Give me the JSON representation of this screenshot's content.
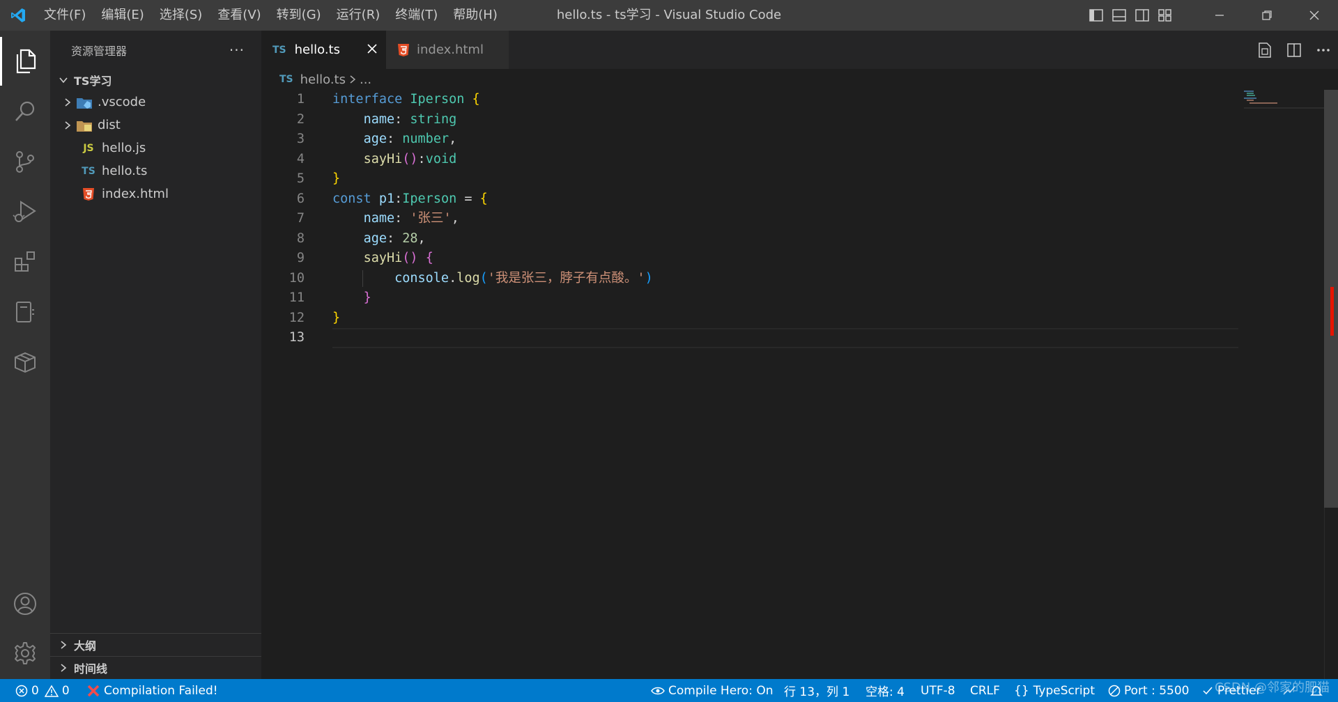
{
  "titlebar": {
    "window_title": "hello.ts - ts学习 - Visual Studio Code",
    "menu": [
      "文件(F)",
      "编辑(E)",
      "选择(S)",
      "查看(V)",
      "转到(G)",
      "运行(R)",
      "终端(T)",
      "帮助(H)"
    ],
    "logo_icon": "vscode-logo-icon",
    "layout_icons": [
      "toggle-primary-sidebar-icon",
      "toggle-panel-icon",
      "toggle-secondary-sidebar-icon",
      "customize-layout-icon"
    ],
    "window_controls": [
      "minimize-icon",
      "restore-icon",
      "close-icon"
    ]
  },
  "activity_bar": {
    "items": [
      "explorer-icon",
      "search-icon",
      "source-control-icon",
      "run-debug-icon",
      "extensions-icon",
      "remote-explorer-icon",
      "package-icon"
    ],
    "bottom": [
      "accounts-icon",
      "manage-gear-icon"
    ],
    "active": "explorer-icon"
  },
  "sidebar": {
    "title": "资源管理器",
    "more": "···",
    "root": "TS学习",
    "items": [
      {
        "label": ".vscode",
        "kind": "folder",
        "icon": "vscode-folder-icon"
      },
      {
        "label": "dist",
        "kind": "folder",
        "icon": "folder-icon"
      },
      {
        "label": "hello.js",
        "kind": "file",
        "badge": "JS",
        "badge_color": "#cbcb41"
      },
      {
        "label": "hello.ts",
        "kind": "file",
        "badge": "TS",
        "badge_color": "#519aba"
      },
      {
        "label": "index.html",
        "kind": "file",
        "icon": "html5-icon",
        "badge_color": "#e44d26"
      }
    ],
    "sections": [
      "大纲",
      "时间线"
    ]
  },
  "tabs": [
    {
      "label": "hello.ts",
      "lang": "TS",
      "active": true
    },
    {
      "label": "index.html",
      "lang": "html5",
      "active": false
    }
  ],
  "breadcrumb": {
    "lang": "TS",
    "file": "hello.ts",
    "rest": "..."
  },
  "editor": {
    "current_line": 13,
    "lines": [
      [
        [
          "kw",
          "interface"
        ],
        [
          "op",
          " "
        ],
        [
          "ty",
          "Iperson"
        ],
        [
          "op",
          " "
        ],
        [
          "b1",
          "{"
        ]
      ],
      [
        [
          "op",
          "    "
        ],
        [
          "pr",
          "name"
        ],
        [
          "op",
          ": "
        ],
        [
          "ty",
          "string"
        ]
      ],
      [
        [
          "op",
          "    "
        ],
        [
          "pr",
          "age"
        ],
        [
          "op",
          ": "
        ],
        [
          "ty",
          "number"
        ],
        [
          "op",
          ","
        ]
      ],
      [
        [
          "op",
          "    "
        ],
        [
          "fn",
          "sayHi"
        ],
        [
          "b2",
          "()"
        ],
        [
          "op",
          ":"
        ],
        [
          "ty",
          "void"
        ]
      ],
      [
        [
          "b1",
          "}"
        ]
      ],
      [
        [
          "kw",
          "const"
        ],
        [
          "op",
          " "
        ],
        [
          "pr",
          "p1"
        ],
        [
          "op",
          ":"
        ],
        [
          "ty",
          "Iperson"
        ],
        [
          "op",
          " = "
        ],
        [
          "b1",
          "{"
        ]
      ],
      [
        [
          "op",
          "    "
        ],
        [
          "pr",
          "name"
        ],
        [
          "op",
          ": "
        ],
        [
          "st",
          "'张三'"
        ],
        [
          "op",
          ","
        ]
      ],
      [
        [
          "op",
          "    "
        ],
        [
          "pr",
          "age"
        ],
        [
          "op",
          ": "
        ],
        [
          "nu",
          "28"
        ],
        [
          "op",
          ","
        ]
      ],
      [
        [
          "op",
          "    "
        ],
        [
          "fn",
          "sayHi"
        ],
        [
          "b2",
          "()"
        ],
        [
          "op",
          " "
        ],
        [
          "b2",
          "{"
        ]
      ],
      [
        [
          "op",
          "        "
        ],
        [
          "pr",
          "console"
        ],
        [
          "op",
          "."
        ],
        [
          "fn",
          "log"
        ],
        [
          "b3",
          "("
        ],
        [
          "st",
          "'我是张三，脖子有点酸。'"
        ],
        [
          "b3",
          ")"
        ]
      ],
      [
        [
          "op",
          "    "
        ],
        [
          "b2",
          "}"
        ]
      ],
      [
        [
          "b1",
          "}"
        ]
      ],
      []
    ]
  },
  "statusbar": {
    "errors": "0",
    "warnings": "0",
    "compilation": "Compilation Failed!",
    "compile_hero": "Compile Hero: On",
    "position": "行 13，列 1",
    "spaces": "空格: 4",
    "encoding": "UTF-8",
    "eol": "CRLF",
    "language": "TypeScript",
    "port": "Port : 5500",
    "prettier": "Prettier",
    "watermark": "CSDN @邻家的肥猫"
  },
  "colors": {
    "accent": "#007acc",
    "titlebar": "#3c3c3c",
    "activitybar": "#333333",
    "sidebar": "#252526",
    "editor": "#1e1e1e",
    "error": "#e51400"
  }
}
